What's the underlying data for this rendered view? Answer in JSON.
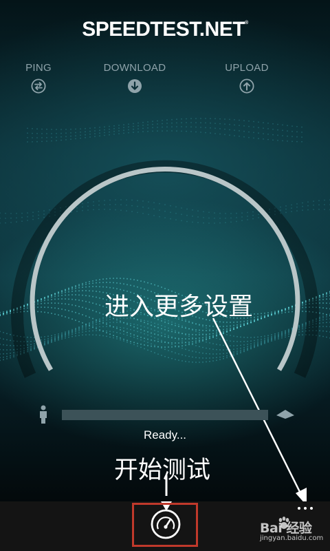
{
  "app": {
    "logo_text": "SPEEDTEST.NET",
    "logo_mark": "®"
  },
  "metrics": [
    {
      "label": "PING",
      "icon": "swap-arrows-icon"
    },
    {
      "label": "DOWNLOAD",
      "icon": "download-arrow-icon"
    },
    {
      "label": "UPLOAD",
      "icon": "upload-arrow-icon"
    }
  ],
  "gauge": {
    "icon": "speed-gauge-arc"
  },
  "progress": {
    "fraction": 0,
    "start_icon": "person-icon",
    "end_icon": "server-icon"
  },
  "status": "Ready...",
  "annotations": {
    "settings": "进入更多设置",
    "start": "开始测试"
  },
  "appbar": {
    "go_icon": "speedometer-icon",
    "more_icon": "more-dots-icon"
  },
  "watermark": {
    "main": "Bai 经验",
    "sub": "jingyan.baidu.com"
  },
  "colors": {
    "background": "#0e3740",
    "arc": "#b9c6c8",
    "progress_track": "#3c5258",
    "highlight": "#c0392b",
    "appbar": "#141414"
  }
}
